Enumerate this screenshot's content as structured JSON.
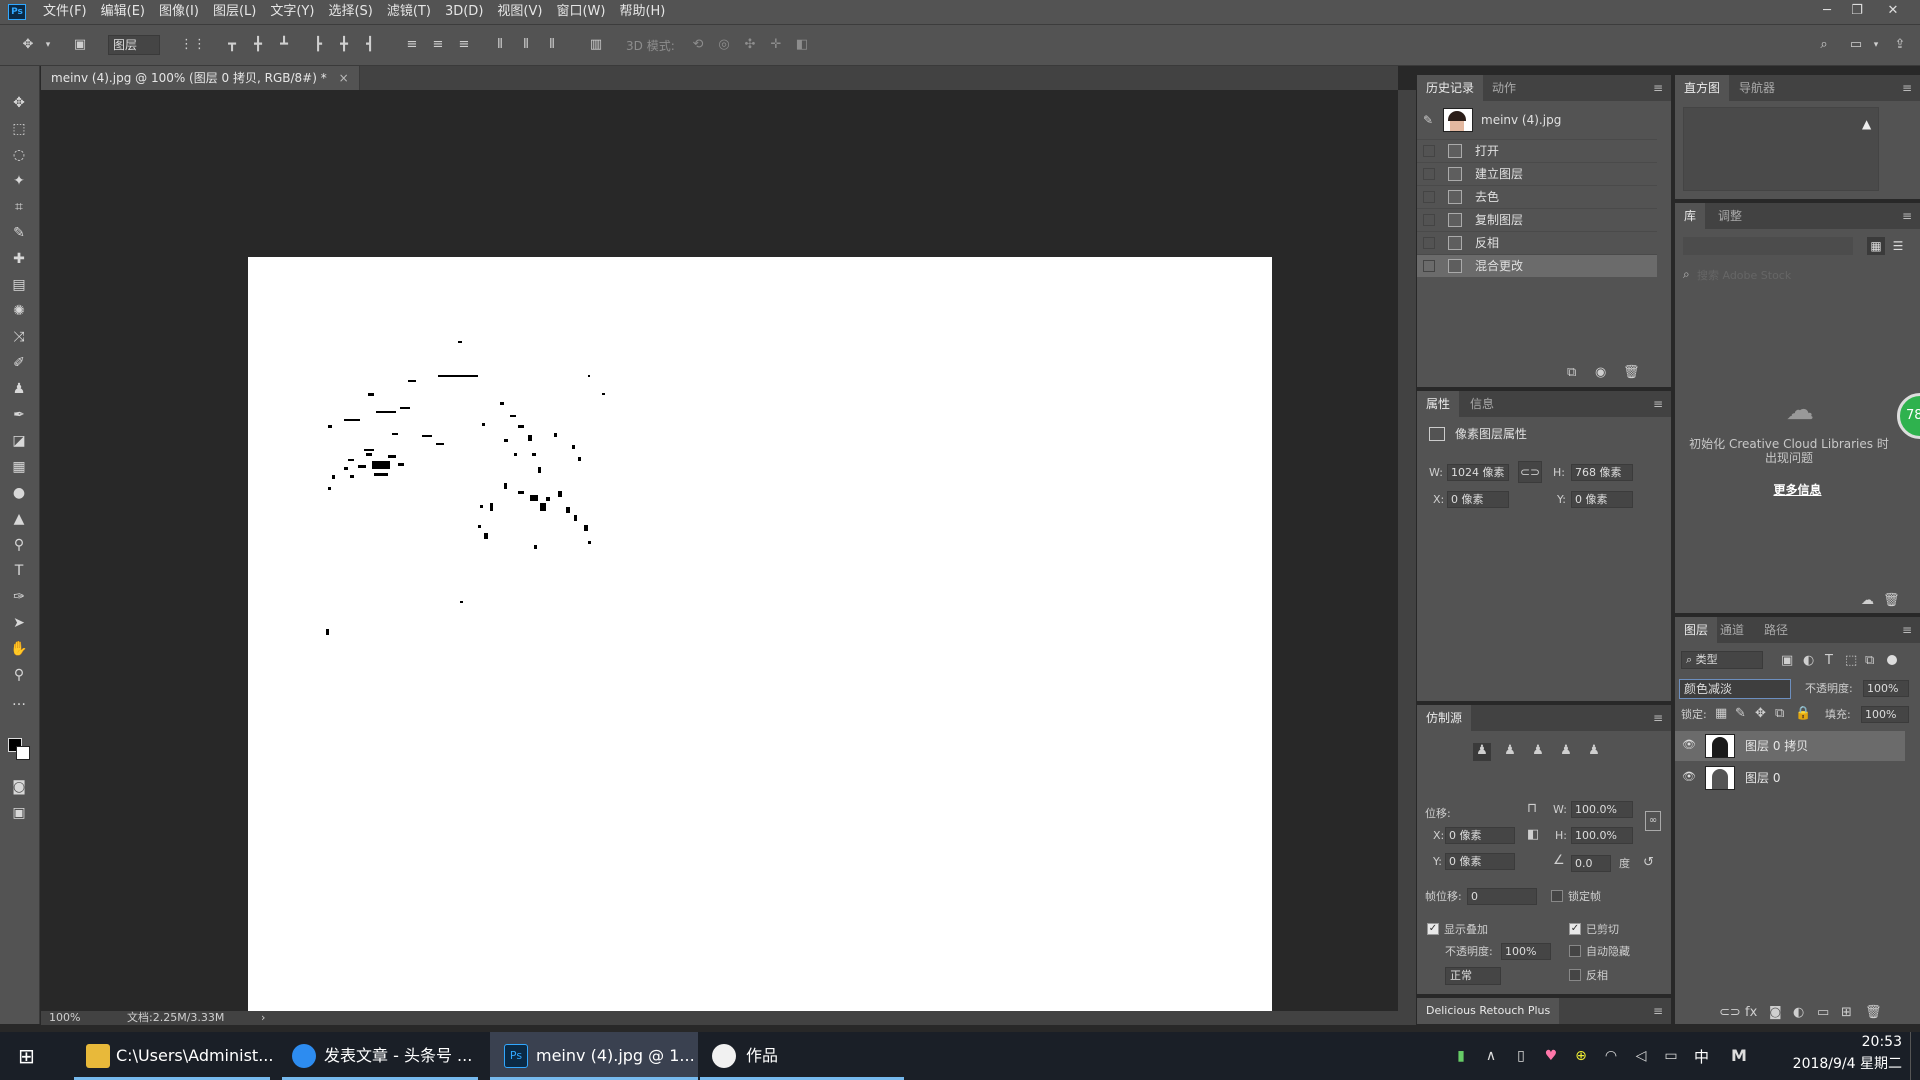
{
  "app": {
    "logo": "Ps"
  },
  "menu": [
    "文件(F)",
    "编辑(E)",
    "图像(I)",
    "图层(L)",
    "文字(Y)",
    "选择(S)",
    "滤镜(T)",
    "3D(D)",
    "视图(V)",
    "窗口(W)",
    "帮助(H)"
  ],
  "options_bar": {
    "auto_select_value": "图层",
    "mode_3d_label": "3D 模式:"
  },
  "document": {
    "tab_title": "meinv (4).jpg @ 100% (图层 0 拷贝, RGB/8#) *",
    "zoom": "100%",
    "doc_size": "文档:2.25M/3.33M"
  },
  "history_panel": {
    "tabs": [
      "历史记录",
      "动作"
    ],
    "snapshot": "meinv (4).jpg",
    "items": [
      "打开",
      "建立图层",
      "去色",
      "复制图层",
      "反相",
      "混合更改"
    ]
  },
  "histogram_panel": {
    "tabs": [
      "直方图",
      "导航器"
    ]
  },
  "library_panel": {
    "tabs": [
      "库",
      "调整"
    ],
    "search_placeholder": "搜索 Adobe Stock",
    "message": "初始化 Creative Cloud Libraries 时出现问题",
    "more_info": "更多信息",
    "badge": "78"
  },
  "properties_panel": {
    "tabs": [
      "属性",
      "信息"
    ],
    "title": "像素图层属性",
    "w_label": "W:",
    "w": "1024 像素",
    "h_label": "H:",
    "h": "768 像素",
    "x_label": "X:",
    "x": "0 像素",
    "y_label": "Y:",
    "y": "0 像素"
  },
  "clone_panel": {
    "tab": "仿制源",
    "offset_label": "位移:",
    "x_label": "X:",
    "x": "0 像素",
    "y_label": "Y:",
    "y": "0 像素",
    "w_label": "W:",
    "w": "100.0%",
    "h_label": "H:",
    "h": "100.0%",
    "angle": "0.0",
    "angle_unit": "度",
    "frame_offset_label": "帧位移:",
    "frame_offset": "0",
    "lock_frame": "锁定帧",
    "show_overlay": "显示叠加",
    "opacity_label": "不透明度:",
    "opacity": "100%",
    "clipped": "已剪切",
    "auto_hide": "自动隐藏",
    "invert": "反相",
    "blend_mode": "正常"
  },
  "delicious_panel": {
    "tab": "Delicious Retouch Plus"
  },
  "layers_panel": {
    "tabs": [
      "图层",
      "通道",
      "路径"
    ],
    "filter_kind": "类型",
    "blend_mode": "颜色减淡",
    "opacity_label": "不透明度:",
    "opacity": "100%",
    "lock_label": "锁定:",
    "fill_label": "填充:",
    "fill": "100%",
    "layers": [
      {
        "name": "图层 0 拷贝",
        "selected": true
      },
      {
        "name": "图层 0",
        "selected": false
      }
    ]
  },
  "taskbar": {
    "apps": [
      {
        "label": "C:\\Users\\Administ...",
        "icon": "folder-icon"
      },
      {
        "label": "发表文章 - 头条号 ...",
        "icon": "sogou-browser-icon"
      },
      {
        "label": "meinv (4).jpg @ 1...",
        "icon": "photoshop-icon"
      },
      {
        "label": "作品",
        "icon": "app-avatar-icon"
      }
    ],
    "ime": "中",
    "time": "20:53",
    "date": "2018/9/4 星期二"
  },
  "colors": {
    "ps_blue": "#31a8ff",
    "panel": "#535353",
    "dark": "#282828"
  }
}
